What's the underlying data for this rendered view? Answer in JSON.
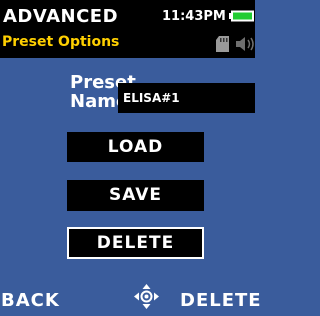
{
  "header": {
    "title": "ADVANCED",
    "clock": "11:43PM",
    "subtitle": "Preset Options",
    "icons": [
      "battery-icon",
      "sd-card-icon",
      "speaker-icon"
    ]
  },
  "preset": {
    "label_line1": "Preset",
    "label_line2": "Name",
    "name_value": "ELISA#1"
  },
  "buttons": {
    "load": "LOAD",
    "save": "SAVE",
    "delete": "DELETE"
  },
  "softkeys": {
    "left": "BACK",
    "center_icon": "navigation-dpad-icon",
    "right": "DELETE"
  },
  "colors": {
    "background": "#3a5c9c",
    "header": "#000000",
    "subtitle": "#ffd000",
    "battery": "#22cc33"
  }
}
